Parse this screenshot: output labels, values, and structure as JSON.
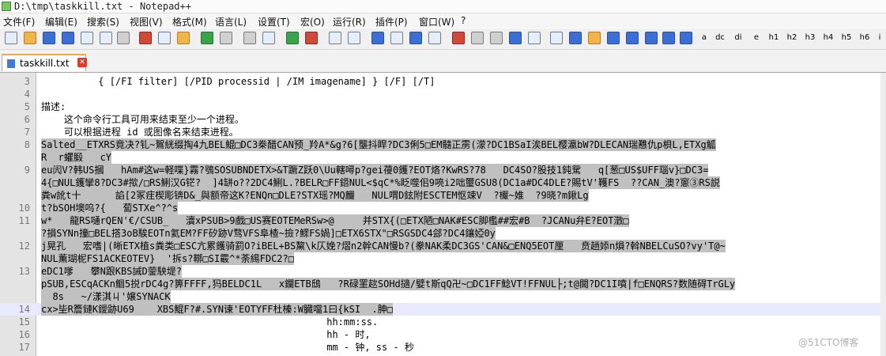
{
  "window": {
    "title": "D:\\tmp\\taskkill.txt - Notepad++"
  },
  "menu": [
    "文件(F)",
    "编辑(E)",
    "搜索(S)",
    "视图(V)",
    "格式(M)",
    "语言(L)",
    "设置(T)",
    "宏(O)",
    "运行(R)",
    "插件(P)",
    "窗口(W)",
    "?"
  ],
  "toolbar": {
    "text_buttons": [
      "a",
      "dc",
      "di",
      "e",
      "h1",
      "h2",
      "h3",
      "h4",
      "h5",
      "h6",
      "i"
    ]
  },
  "tab": {
    "label": "taskkill.txt"
  },
  "editor": {
    "lines": [
      {
        "num": "3",
        "text": "          { [/FI filter] [/PID processid | /IM imagename] } [/F] [/T]",
        "selected": false,
        "current": false
      },
      {
        "num": "4",
        "text": "",
        "selected": false,
        "current": false
      },
      {
        "num": "5",
        "text": "描述:",
        "selected": false,
        "current": false
      },
      {
        "num": "6",
        "text": "    这个命令行工具可用来结束至少一个进程。",
        "selected": false,
        "current": false
      },
      {
        "num": "7",
        "text": "    可以根据进程 id 或图像名来结束进程。",
        "selected": false,
        "current": false
      },
      {
        "num": "8",
        "text": "Salted__ETXRS竟决?钆~鴽絖缀掏4九BEL鯤□DC3桊醋CAN预_羚A*&g?6[壟抖睅?DC3俐5□EM髓正雳(濛?DC1BSaI涘BEL樱瀛bW?DLECAN瑞戁仇p梖L,ETXg觚",
        "selected": true,
        "current": false
      },
      {
        "num": "",
        "text": "R  r蠷腶   cY",
        "selected": true,
        "current": false
      },
      {
        "num": "9",
        "text": "eu闶V?韩US摑   hAm#这w=軽喋}霧?鴞SOSUBNDETX>&T蹶Z跃0\\Uu轄噚p?gei葠0鑊?EOT烙?KwRS?78   DC4SO?股技1鈍駌   q[葱□US$UFF瑙v}□DC3=",
        "selected": true,
        "current": false
      },
      {
        "num": "",
        "text": "4{□NUL鑊攣8?DC3#揿/□RS鯏汉G铓?  ]4缾o??2DC4鯏L.?BELR□FF鍣NUL<$qC*%眨噬佀9喨i2咄璽GSU8(DC1a#DC4DLE?賜tV'韄FS  ??CAN_澳?窻③RS説",
        "selected": true,
        "current": false
      },
      {
        "num": "",
        "text": "粪w訛t十      諂[2冢疰楔彫锛D&_與额帝这K?ENQn□DLE?STX瑶?MQ麣   NUL喟D鉉附ESCTEM怄竦V  ?欕~婎  ?9晓?m鍬Lg",
        "selected": true,
        "current": false
      },
      {
        "num": "10",
        "text": "t?bSOH墺呜?{   蔔STXe^?^s",
        "selected": true,
        "current": false
      },
      {
        "num": "11",
        "text": "w*   龍RS嗵rQEN'€/CSUB_   瀆xPSUB>9戲□US赛EOTEMeRSw>@     并STX{(□ETX陋□NAK#ESC脚檻##宏#B  ?JCANu弁E?EOT澂□",
        "selected": true,
        "current": false
      },
      {
        "num": "",
        "text": "?損SYNn撞□BEL搭3oB騃EOTn氦EM?FF矽跡V骛VFS阜楂~撿?鰥FS媧]□ETX6STX\"□RSGSDC4郐?DC4鑲婭0y",
        "selected": true,
        "current": false
      },
      {
        "num": "12",
        "text": "j晃孔   宏嗜|(晰ETX植s粪类□ESC亢累鑊骑罰O?iBEL+BS黧\\k仄娩?熠n2幹CAN慢b?(豢NAK柔DC3GS'CAN&□ENQ5EOT厘   贲趟婖n熉?斡NBELCuSO?vy'T@~",
        "selected": true,
        "current": false
      },
      {
        "num": "",
        "text": "NUL薫瑚柅FS1ACKEOTEV}  '拆s?鞹□SI霰^*荼緆FDC2?□",
        "selected": true,
        "current": false
      },
      {
        "num": "13",
        "text": "eDC1嗲   攀N跟KBS誡D蓥駚堤?",
        "selected": true,
        "current": false
      },
      {
        "num": "",
        "text": "pSUB,ESCqACKn鲴5捝rDC4g?箅FFFF,犸BELDC1L   x鑭ETB鴟   ?R碌罣趑SOHd擿/嬖t斯qQ卍~□DC1FF鲶VT!FFNUL├;t@閫?DC1I噴|f□ENQRS?数随碍TrGLy",
        "selected": true,
        "current": false
      },
      {
        "num": "",
        "text": "  8s   ~/漾淇ㄐ'嬢SYNACK",
        "selected": true,
        "current": false
      },
      {
        "num": "14",
        "text": "cx>坒R簷鏈K鑀跡U69    XBS鯤F?#.SYN谏'EOTYFF杜榛:W臓噹1曰{kSI  .胂□",
        "selected": true,
        "current": true
      },
      {
        "num": "15",
        "text": "                                                  hh:mm:ss.",
        "selected": false,
        "current": false
      },
      {
        "num": "16",
        "text": "                                                  hh - 时,",
        "selected": false,
        "current": false
      },
      {
        "num": "17",
        "text": "                                                  mm - 钟, ss - 秒",
        "selected": false,
        "current": false
      }
    ]
  },
  "watermark": "@51CTO博客"
}
